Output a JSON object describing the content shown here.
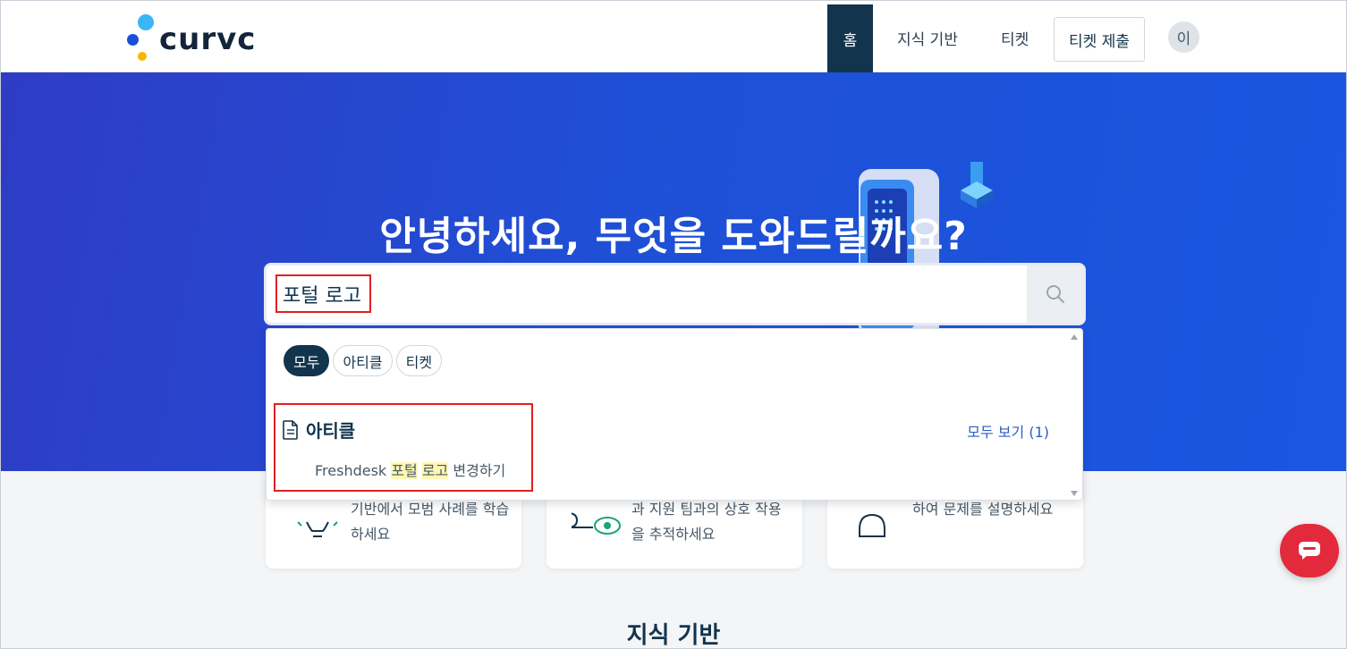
{
  "brand": {
    "name": "curvc"
  },
  "nav": {
    "home": "홈",
    "knowledge_base": "지식 기반",
    "tickets": "티켓",
    "submit_ticket": "티켓 제출",
    "avatar_initial": "이"
  },
  "hero": {
    "title": "안녕하세요, 무엇을 도와드릴까요?"
  },
  "search": {
    "query": "포털 로고",
    "icon": "search-icon"
  },
  "dropdown": {
    "filters": [
      "모두",
      "아티클",
      "티켓"
    ],
    "active_filter": "모두",
    "section": {
      "title": "아티클",
      "view_all": "모두 보기",
      "view_all_count": "(1)",
      "icon": "document-icon"
    },
    "result": {
      "prefix": "Freshdesk",
      "match1": "포털",
      "match2": "로고",
      "suffix": "변경하기"
    }
  },
  "cards": [
    {
      "text": "기반에서 모범 사례를 학습하세요",
      "icon": "lightbulb-icon"
    },
    {
      "text": "과 지원 팀과의 상호 작용을 추적하세요",
      "icon": "eye-ticket-icon"
    },
    {
      "text": "하여 문제를 설명하세요",
      "icon": "person-icon"
    }
  ],
  "section_title": "지식 기반",
  "colors": {
    "primary": "#12344d",
    "hero": "#1f4fd6",
    "accent": "#e32a3d",
    "link": "#2c5cc5",
    "highlight": "#e02020"
  }
}
